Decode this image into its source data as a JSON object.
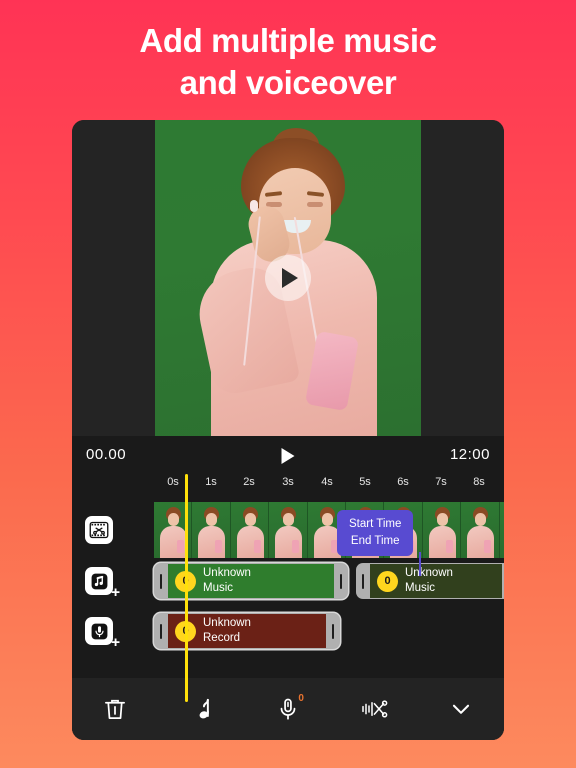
{
  "headline": {
    "line1": "Add multiple music",
    "line2": "and voiceover"
  },
  "player": {
    "play_button_icon": "play-icon"
  },
  "timeline": {
    "current_time": "00.00",
    "total_time": "12:00",
    "play_icon": "play-icon",
    "ruler_ticks": [
      "0s",
      "1s",
      "2s",
      "3s",
      "4s",
      "5s",
      "6s",
      "7s",
      "8s"
    ],
    "playhead_position_seconds": 0.8,
    "tooltip": {
      "line1": "Start Time",
      "line2": "End Time",
      "color": "#584BD1"
    },
    "tracks": [
      {
        "name": "video-track",
        "icon": "film-scissors-icon",
        "add_badge": false,
        "clips": []
      },
      {
        "name": "music-track",
        "icon": "music-add-icon",
        "add_badge": true,
        "clips": [
          {
            "badge": "0",
            "title": "Unknown",
            "subtitle": "Music",
            "selected": true,
            "color": "#2F7D2D"
          },
          {
            "badge": "0",
            "title": "Unknown",
            "subtitle": "Music",
            "selected": false,
            "color": "#31401D"
          }
        ]
      },
      {
        "name": "record-track",
        "icon": "mic-add-icon",
        "add_badge": true,
        "clips": [
          {
            "badge": "0",
            "title": "Unknown",
            "subtitle": "Record",
            "selected": true,
            "color": "#6B2116"
          }
        ]
      }
    ]
  },
  "toolbar": {
    "items": [
      {
        "icon": "trash-icon",
        "label": "Delete",
        "badge": null
      },
      {
        "icon": "music-note-icon",
        "label": "Music",
        "badge": null
      },
      {
        "icon": "microphone-icon",
        "label": "Voiceover",
        "badge": "0"
      },
      {
        "icon": "audio-cut-icon",
        "label": "Audio Cut",
        "badge": null
      },
      {
        "icon": "chevron-down-icon",
        "label": "Collapse",
        "badge": null
      }
    ]
  },
  "colors": {
    "background_top": "#FF3355",
    "background_bottom": "#FD8A5E",
    "playhead": "#FFE00A",
    "badge": "#FFD61E",
    "accent_orange": "#E8732F"
  }
}
